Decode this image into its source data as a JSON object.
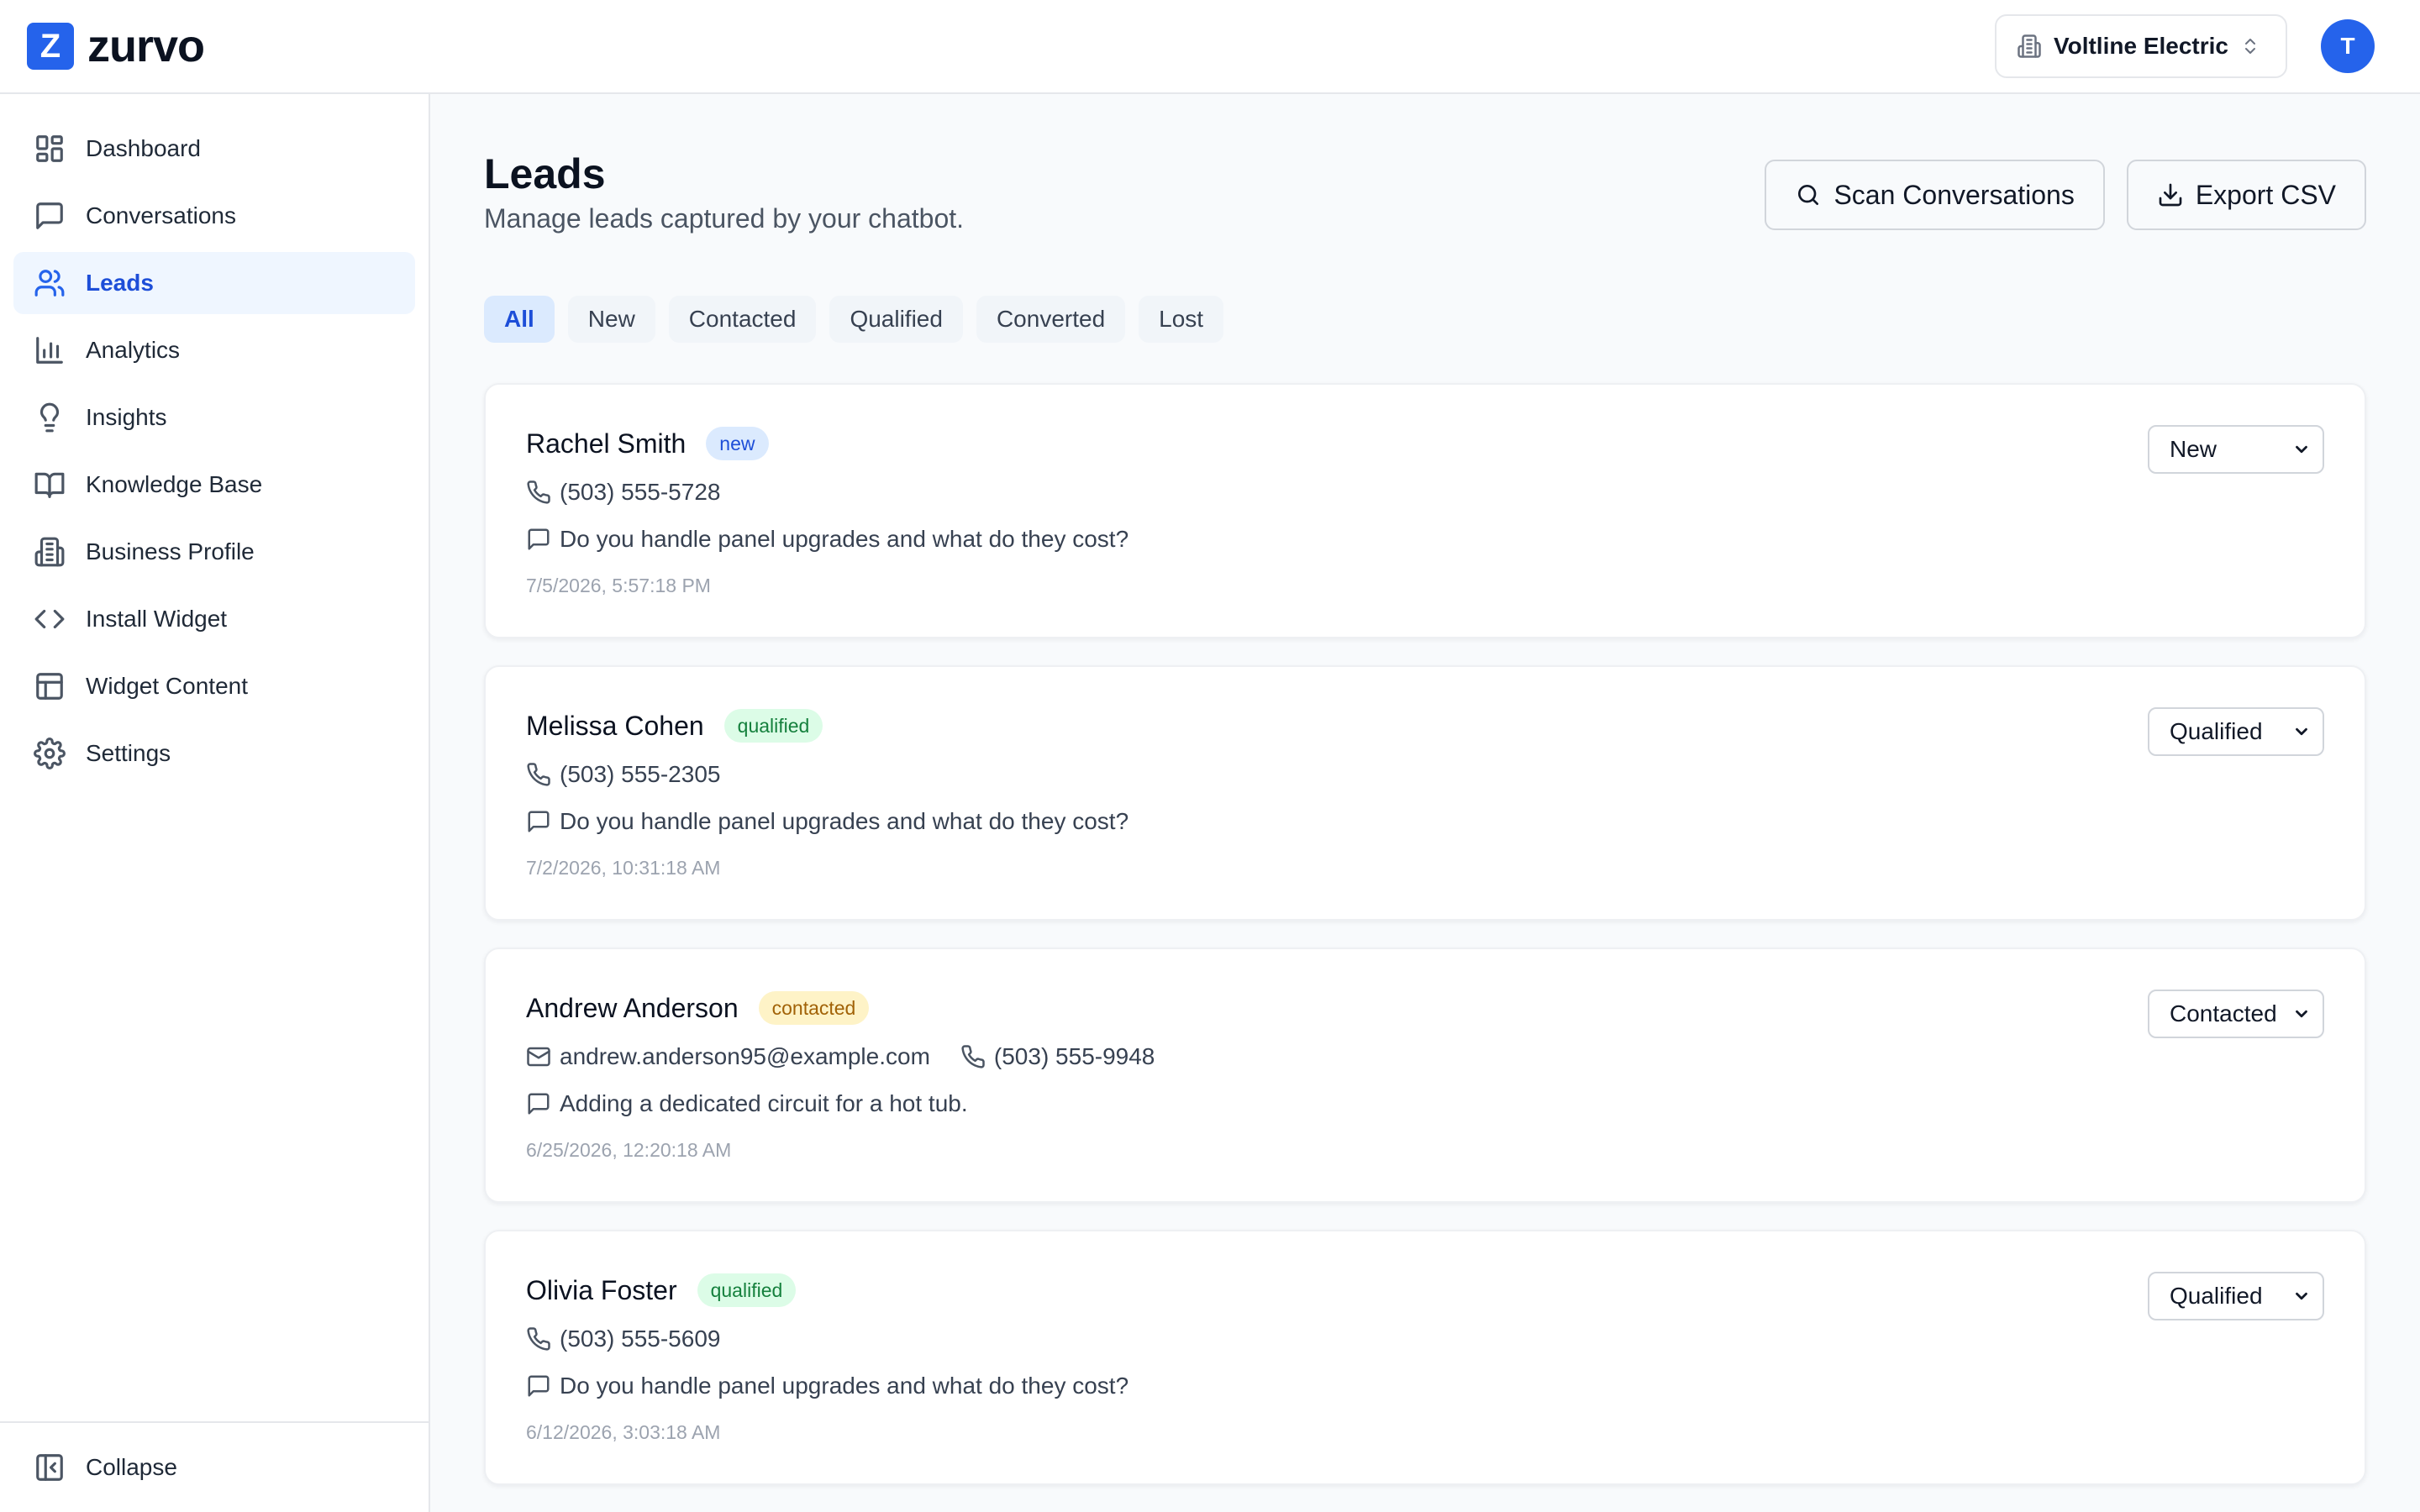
{
  "app": {
    "brand_letter": "Z",
    "brand_name": "zurvo"
  },
  "header": {
    "business_name": "Voltline Electric",
    "avatar_initial": "T"
  },
  "sidebar": {
    "items": [
      {
        "label": "Dashboard",
        "icon": "dashboard-icon"
      },
      {
        "label": "Conversations",
        "icon": "chat-icon"
      },
      {
        "label": "Leads",
        "icon": "users-icon",
        "active": true
      },
      {
        "label": "Analytics",
        "icon": "bar-chart-icon"
      },
      {
        "label": "Insights",
        "icon": "lightbulb-icon"
      },
      {
        "label": "Knowledge Base",
        "icon": "book-icon"
      },
      {
        "label": "Business Profile",
        "icon": "building-icon"
      },
      {
        "label": "Install Widget",
        "icon": "code-icon"
      },
      {
        "label": "Widget Content",
        "icon": "layout-icon"
      },
      {
        "label": "Settings",
        "icon": "gear-icon"
      }
    ],
    "collapse_label": "Collapse"
  },
  "page": {
    "title": "Leads",
    "subtitle": "Manage leads captured by your chatbot.",
    "scan_button": "Scan Conversations",
    "export_button": "Export CSV"
  },
  "tabs": [
    "All",
    "New",
    "Contacted",
    "Qualified",
    "Converted",
    "Lost"
  ],
  "active_tab": "All",
  "leads": [
    {
      "name": "Rachel Smith",
      "badge": "new",
      "email": "",
      "phone": "(503) 555-5728",
      "message": "Do you handle panel upgrades and what do they cost?",
      "timestamp": "7/5/2026, 5:57:18 PM",
      "status": "New"
    },
    {
      "name": "Melissa Cohen",
      "badge": "qualified",
      "email": "",
      "phone": "(503) 555-2305",
      "message": "Do you handle panel upgrades and what do they cost?",
      "timestamp": "7/2/2026, 10:31:18 AM",
      "status": "Qualified"
    },
    {
      "name": "Andrew Anderson",
      "badge": "contacted",
      "email": "andrew.anderson95@example.com",
      "phone": "(503) 555-9948",
      "message": "Adding a dedicated circuit for a hot tub.",
      "timestamp": "6/25/2026, 12:20:18 AM",
      "status": "Contacted"
    },
    {
      "name": "Olivia Foster",
      "badge": "qualified",
      "email": "",
      "phone": "(503) 555-5609",
      "message": "Do you handle panel upgrades and what do they cost?",
      "timestamp": "6/12/2026, 3:03:18 AM",
      "status": "Qualified"
    }
  ],
  "colors": {
    "accent": "#2563eb",
    "active_nav_bg": "#eff6ff",
    "badge_new": "#dbeafe",
    "badge_qualified": "#dcfce7",
    "badge_contacted": "#fef3c7"
  }
}
